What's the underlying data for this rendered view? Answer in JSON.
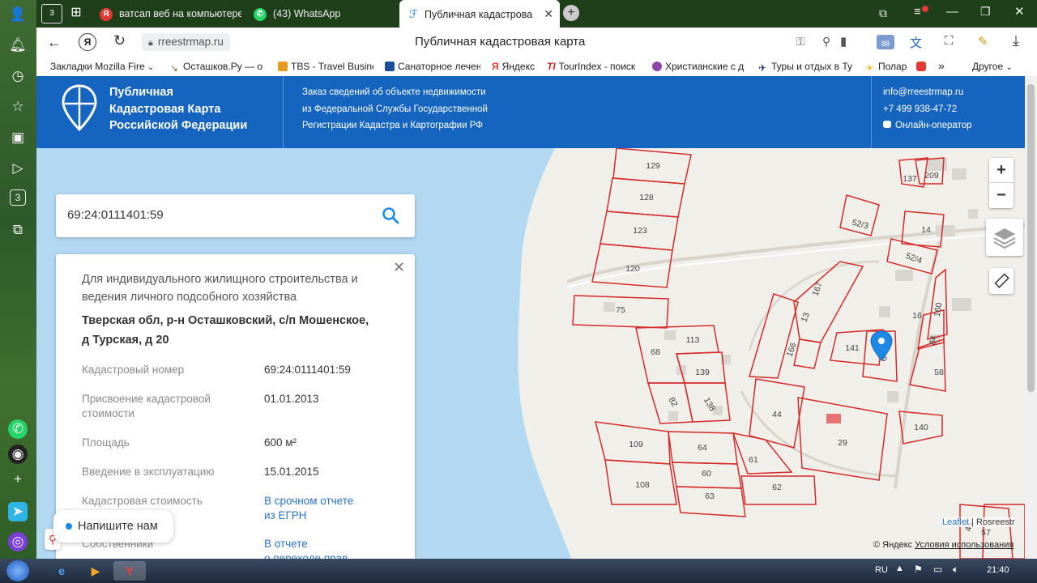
{
  "browser": {
    "tabs": [
      {
        "label": "ватсап веб на компьютере",
        "icon": "yandex-icon"
      },
      {
        "label": "(43) WhatsApp",
        "icon": "whatsapp-icon"
      },
      {
        "label": "Публичная кадастрова",
        "icon": "cadastral-icon",
        "active": true
      }
    ],
    "tab_counter": "3",
    "whatsapp_badge": "43",
    "url": "rreestrmap.ru",
    "page_title": "Публичная кадастровая карта",
    "bookmarks": [
      "Закладки Mozilla Fire",
      "Осташков.Ру — о",
      "TBS - Travel Busine",
      "Санаторное лечен",
      "Яндекс",
      "TourIndex - поиск",
      "Христианские с д",
      "Туры и отдых в Ту",
      "Полар"
    ],
    "bookmarks_other": "Другое",
    "ext_badge": "88"
  },
  "site": {
    "logo_line1": "Публичная",
    "logo_line2": "Кадастровая Карта",
    "logo_line3": "Российской Федерации",
    "desc_line1": "Заказ сведений об объекте недвижимости",
    "desc_line2": "из Федеральной Службы Государственной",
    "desc_line3": "Регистрации Кадастра и Картографии РФ",
    "email": "info@rreestrmap.ru",
    "phone": "+7 499 938-47-72",
    "online": "Онлайн-оператор"
  },
  "search": {
    "value": "69:24:0111401:59"
  },
  "info": {
    "purpose_line1": "Для индивидуального жилищного строительства и",
    "purpose_line2": "ведения личного подсобного хозяйства",
    "address_line1": "Тверская обл, р-н Осташковский, с/п Мошенское,",
    "address_line2": "д Турская, д 20",
    "rows": [
      {
        "label": "Кадастровый номер",
        "value": "69:24:0111401:59"
      },
      {
        "label": "Присвоение кадастровой",
        "label2": "стоимости",
        "value": "01.01.2013"
      },
      {
        "label": "Площадь",
        "value": "600 м²"
      },
      {
        "label": "Введение в эксплуатацию",
        "value": "15.01.2015"
      },
      {
        "label": "Кадастровая стоимость",
        "value": "В срочном отчете",
        "value2": "из ЕГРН"
      },
      {
        "label": "Собственники",
        "value": "В отчете",
        "value2": "о переходе прав"
      }
    ]
  },
  "chat": {
    "label": "Напишите нам"
  },
  "map": {
    "zoom_in": "+",
    "zoom_out": "−",
    "attribution_leaflet": "Leaflet",
    "attribution_sep": " | Rosreestr",
    "yandex_copy": "© Яндекс",
    "yandex_terms": "Условия использования",
    "parcels": [
      "129",
      "128",
      "123",
      "120",
      "75",
      "113",
      "68",
      "139",
      "138",
      "82",
      "166",
      "167",
      "13",
      "52/3",
      "52/4",
      "141",
      "59",
      "16",
      "84",
      "58",
      "160",
      "14",
      "137",
      "209",
      "44",
      "29",
      "140",
      "109",
      "64",
      "60",
      "61",
      "108",
      "63",
      "62",
      "57",
      "43"
    ]
  },
  "taskbar": {
    "lang": "RU",
    "time": "21:40"
  },
  "colors": {
    "header": "#1565c0",
    "water": "#b3d9f2",
    "parcel": "#d42a2a",
    "marker": "#1e88e5"
  }
}
